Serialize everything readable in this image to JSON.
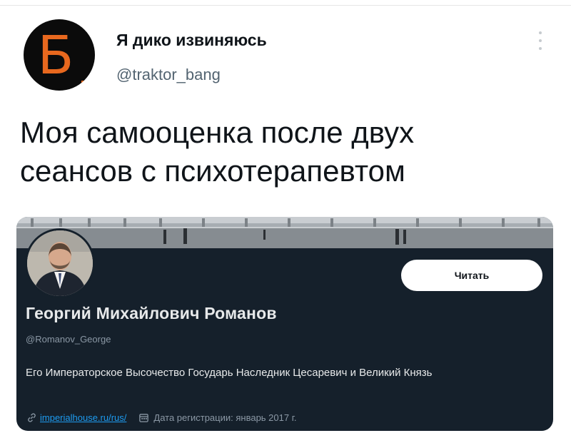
{
  "tweet": {
    "author_avatar_letter": "Б",
    "author_name": "Я дико извиняюсь",
    "author_handle": "@traktor_bang",
    "text_line1": "Моя самооценка после двух",
    "text_line2": "сеансов с психотерапевтом",
    "accent_color": "#e8681e"
  },
  "card": {
    "follow_label": "Читать",
    "name": "Георгий Михайлович Романов",
    "handle": "@Romanov_George",
    "bio": "Его Императорское Высочество Государь Наследник Цесаревич и Великий Князь",
    "link": "imperialhouse.ru/rus/",
    "joined": "Дата регистрации: январь 2017 г.",
    "background_color": "#15202b",
    "link_color": "#1d9bf0"
  },
  "icons": {
    "more": "more-vertical-icon",
    "link": "link-icon",
    "calendar": "calendar-icon"
  }
}
